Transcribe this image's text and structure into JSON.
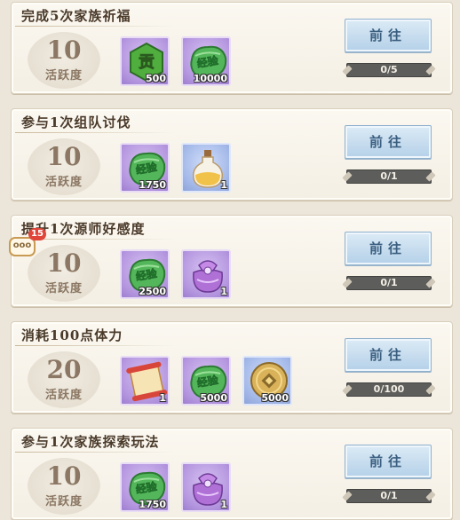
{
  "tasks": [
    {
      "title": "完成5次家族祈福",
      "points": "10",
      "points_label": "活跃度",
      "button": "前往",
      "progress_text": "0/5",
      "progress": 0,
      "rewards": [
        {
          "icon": "contribution-icon",
          "char": "贡",
          "qty": "500",
          "frame": "purple"
        },
        {
          "icon": "exp-icon",
          "char": "经验",
          "qty": "10000",
          "frame": "purple"
        }
      ]
    },
    {
      "title": "参与1次组队讨伐",
      "points": "10",
      "points_label": "活跃度",
      "button": "前往",
      "progress_text": "0/1",
      "progress": 0,
      "rewards": [
        {
          "icon": "exp-icon",
          "char": "经验",
          "qty": "1750",
          "frame": "purple"
        },
        {
          "icon": "potion-bottle-icon",
          "char": "",
          "qty": "1",
          "frame": "blue"
        }
      ]
    },
    {
      "title": "提升1次源师好感度",
      "points": "10",
      "points_label": "活跃度",
      "button": "前往",
      "progress_text": "0/1",
      "progress": 0,
      "rewards": [
        {
          "icon": "exp-icon",
          "char": "经验",
          "qty": "2500",
          "frame": "purple"
        },
        {
          "icon": "gift-bag-icon",
          "char": "",
          "qty": "1",
          "frame": "purple"
        }
      ]
    },
    {
      "title": "消耗100点体力",
      "points": "20",
      "points_label": "活跃度",
      "button": "前往",
      "progress_text": "0/100",
      "progress": 0,
      "rewards": [
        {
          "icon": "scroll-icon",
          "char": "",
          "qty": "1",
          "frame": "purple"
        },
        {
          "icon": "exp-icon",
          "char": "经验",
          "qty": "5000",
          "frame": "purple"
        },
        {
          "icon": "coin-icon",
          "char": "",
          "qty": "5000",
          "frame": "blue"
        }
      ]
    },
    {
      "title": "参与1次家族探索玩法",
      "points": "10",
      "points_label": "活跃度",
      "button": "前往",
      "progress_text": "0/1",
      "progress": 0,
      "rewards": [
        {
          "icon": "exp-icon",
          "char": "经验",
          "qty": "1750",
          "frame": "purple"
        },
        {
          "icon": "gift-bag-icon",
          "char": "",
          "qty": "1",
          "frame": "purple"
        }
      ]
    }
  ],
  "chat": {
    "icon": "chat-bubble-icon",
    "dots": "ooo",
    "unread": "15"
  },
  "colors": {
    "exp_green": "#3fa84a",
    "button_blue": "#b4d0e8",
    "title_brown": "#4a3a2a"
  }
}
